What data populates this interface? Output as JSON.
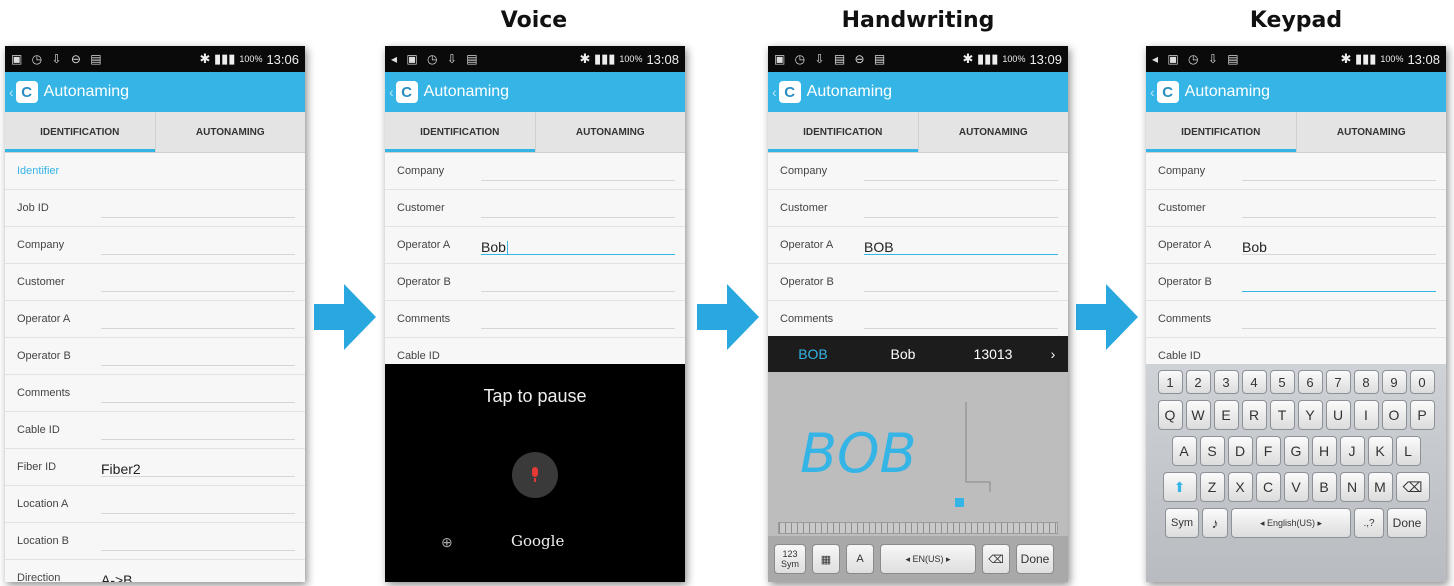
{
  "titles": {
    "voice": "Voice",
    "handwriting": "Handwriting",
    "keypad": "Keypad"
  },
  "app": {
    "name": "Autonaming",
    "tab_identification": "IDENTIFICATION",
    "tab_autonaming": "AUTONAMING"
  },
  "status": {
    "battery": "100%",
    "time1": "13:06",
    "time2": "13:08",
    "time3": "13:09",
    "time4": "13:08"
  },
  "screen1": {
    "section": "Identifier",
    "rows": [
      {
        "label": "Job ID",
        "value": ""
      },
      {
        "label": "Company",
        "value": ""
      },
      {
        "label": "Customer",
        "value": ""
      },
      {
        "label": "Operator A",
        "value": ""
      },
      {
        "label": "Operator B",
        "value": ""
      },
      {
        "label": "Comments",
        "value": ""
      },
      {
        "label": "Cable ID",
        "value": ""
      },
      {
        "label": "Fiber ID",
        "value": "Fiber2"
      },
      {
        "label": "Location A",
        "value": ""
      },
      {
        "label": "Location B",
        "value": ""
      },
      {
        "label": "Direction",
        "value": "A->B"
      }
    ]
  },
  "screen2": {
    "rows": [
      {
        "label": "Company",
        "value": ""
      },
      {
        "label": "Customer",
        "value": ""
      },
      {
        "label": "Operator A",
        "value": "Bob"
      },
      {
        "label": "Operator B",
        "value": ""
      },
      {
        "label": "Comments",
        "value": ""
      },
      {
        "label": "Cable ID",
        "value": ""
      }
    ],
    "voice_prompt": "Tap to pause",
    "voice_provider": "Google"
  },
  "screen3": {
    "rows": [
      {
        "label": "Company",
        "value": ""
      },
      {
        "label": "Customer",
        "value": ""
      },
      {
        "label": "Operator A",
        "value": "BOB"
      },
      {
        "label": "Operator B",
        "value": ""
      },
      {
        "label": "Comments",
        "value": ""
      }
    ],
    "suggestions": [
      "BOB",
      "Bob",
      "13013"
    ],
    "handwriting_text": "BOB",
    "sym_label_top": "123",
    "sym_label_bottom": "Sym",
    "lang": "◂ EN(US) ▸",
    "done": "Done"
  },
  "screen4": {
    "rows": [
      {
        "label": "Company",
        "value": ""
      },
      {
        "label": "Customer",
        "value": ""
      },
      {
        "label": "Operator A",
        "value": "Bob"
      },
      {
        "label": "Operator B",
        "value": ""
      },
      {
        "label": "Comments",
        "value": ""
      },
      {
        "label": "Cable ID",
        "value": ""
      }
    ],
    "keys_num": [
      "1",
      "2",
      "3",
      "4",
      "5",
      "6",
      "7",
      "8",
      "9",
      "0"
    ],
    "keys_row1": [
      "Q",
      "W",
      "E",
      "R",
      "T",
      "Y",
      "U",
      "I",
      "O",
      "P"
    ],
    "keys_row2": [
      "A",
      "S",
      "D",
      "F",
      "G",
      "H",
      "J",
      "K",
      "L"
    ],
    "keys_row3": [
      "Z",
      "X",
      "C",
      "V",
      "B",
      "N",
      "M"
    ],
    "sym": "Sym",
    "lang": "◂ English(US) ▸",
    "punct": ".,?",
    "done": "Done"
  },
  "colors": {
    "accent": "#35b4e6",
    "arrow": "#29a8e0"
  }
}
